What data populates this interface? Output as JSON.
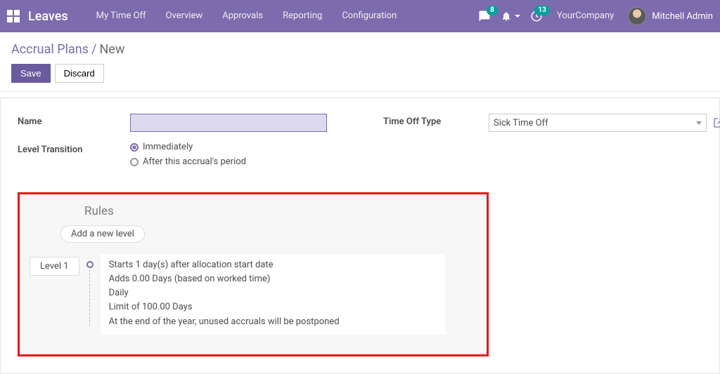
{
  "nav": {
    "brand": "Leaves",
    "items": [
      "My Time Off",
      "Overview",
      "Approvals",
      "Reporting",
      "Configuration"
    ],
    "chat_badge": "8",
    "activity_badge": "13",
    "company": "YourCompany",
    "user": "Mitchell Admin"
  },
  "breadcrumb": {
    "parent": "Accrual Plans",
    "current": "New"
  },
  "actions": {
    "save": "Save",
    "discard": "Discard"
  },
  "form": {
    "name_label": "Name",
    "name_value": "",
    "timeoff_label": "Time Off Type",
    "timeoff_value": "Sick Time Off",
    "transition_label": "Level Transition",
    "transition_opts": {
      "immediately": "Immediately",
      "after": "After this accrual's period"
    }
  },
  "rules": {
    "title": "Rules",
    "add_label": "Add a new level",
    "level_tag": "Level 1",
    "lines": [
      "Starts 1 day(s) after allocation start date",
      "Adds 0.00 Days (based on worked time)",
      "Daily",
      "Limit of 100.00 Days",
      "At the end of the year, unused accruals will be postponed"
    ]
  }
}
